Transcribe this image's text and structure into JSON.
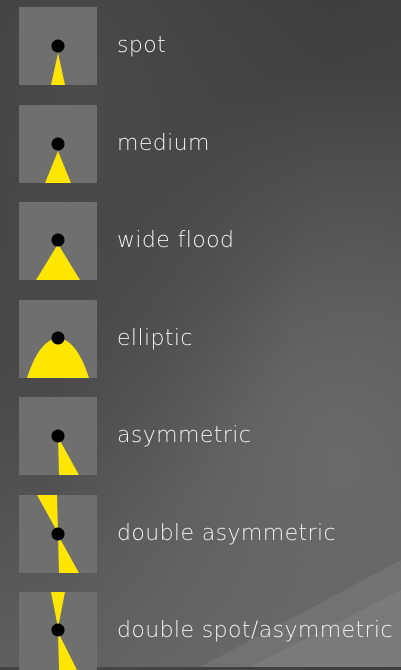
{
  "beam_types": [
    {
      "id": "spot",
      "label": "spot",
      "icon": "spot-beam-icon"
    },
    {
      "id": "medium",
      "label": "medium",
      "icon": "medium-beam-icon"
    },
    {
      "id": "wide-flood",
      "label": "wide flood",
      "icon": "wide-flood-beam-icon"
    },
    {
      "id": "elliptic",
      "label": "elliptic",
      "icon": "elliptic-beam-icon"
    },
    {
      "id": "asymmetric",
      "label": "asymmetric",
      "icon": "asymmetric-beam-icon"
    },
    {
      "id": "double-asymmetric",
      "label": "double asymmetric",
      "icon": "double-asymmetric-beam-icon"
    },
    {
      "id": "double-spot-asymmetric",
      "label": "double spot/asymmetric",
      "icon": "double-spot-asymmetric-beam-icon"
    }
  ],
  "colors": {
    "beam": "#ffe600",
    "source": "#000000",
    "tile": "#6f6f6f",
    "text": "#f1f1f1"
  }
}
